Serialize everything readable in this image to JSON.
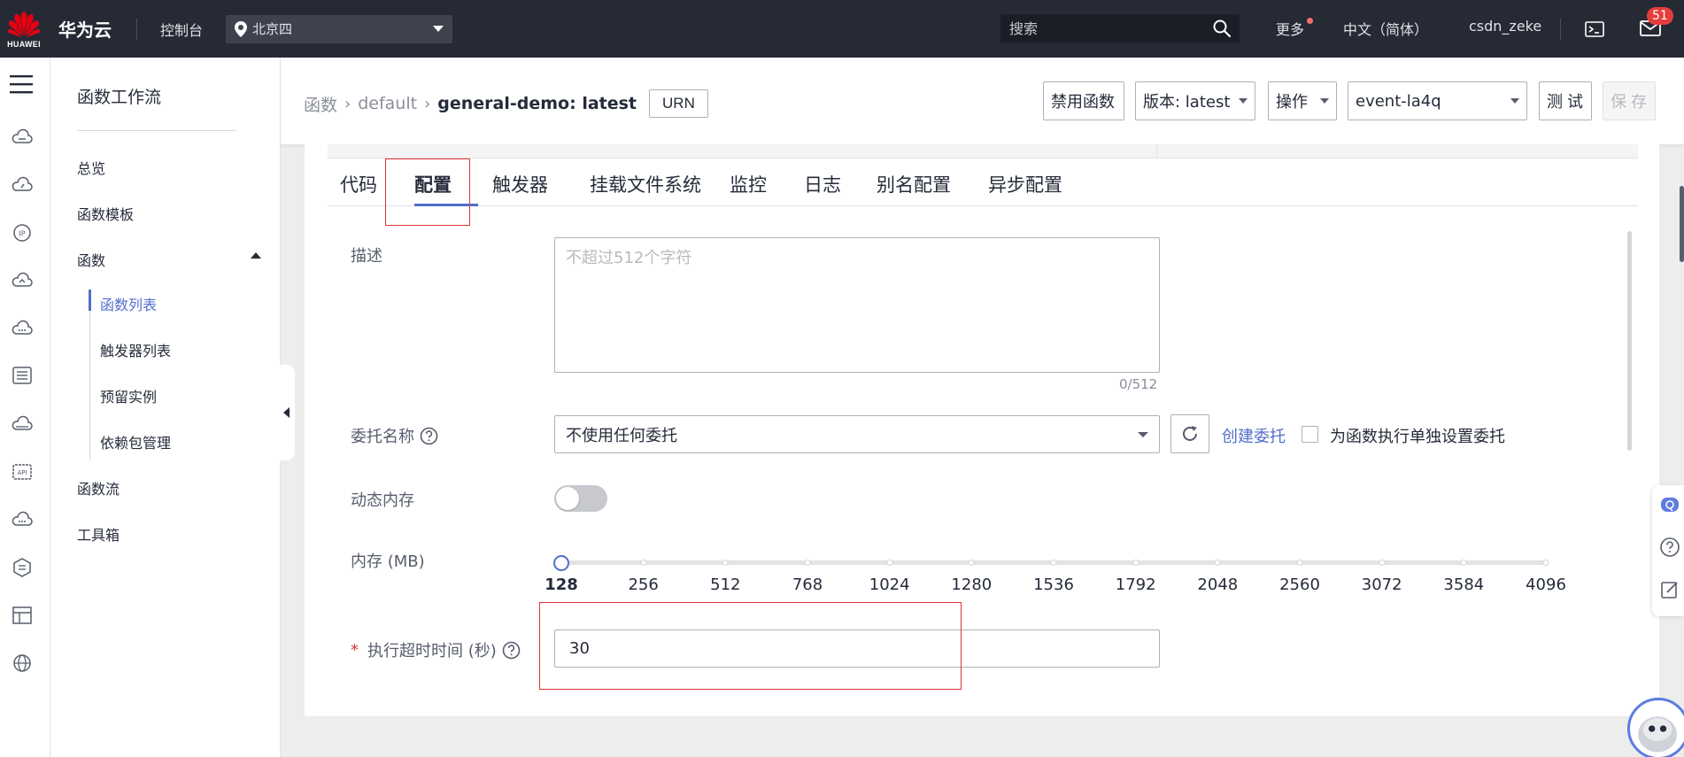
{
  "header": {
    "logo_text": "HUAWEI",
    "brand": "华为云",
    "console": "控制台",
    "region": "北京四",
    "search_placeholder": "搜索",
    "more": "更多",
    "language": "中文（简体）",
    "username": "csdn_zeke",
    "notification_count": "51"
  },
  "sidebar": {
    "title": "函数工作流",
    "items": [
      {
        "label": "总览"
      },
      {
        "label": "函数模板"
      },
      {
        "label": "函数"
      },
      {
        "label": "函数流"
      },
      {
        "label": "工具箱"
      }
    ],
    "sub_items": [
      {
        "label": "函数列表",
        "active": true
      },
      {
        "label": "触发器列表"
      },
      {
        "label": "预留实例"
      },
      {
        "label": "依赖包管理"
      }
    ]
  },
  "breadcrumb": {
    "root": "函数",
    "app": "default",
    "current": "general-demo: latest",
    "urn_label": "URN"
  },
  "toolbar": {
    "disable_label": "禁用函数",
    "version_label": "版本: latest",
    "actions_label": "操作",
    "event_label": "event-la4q",
    "test_label": "测 试",
    "save_label": "保 存"
  },
  "tabs": [
    {
      "label": "代码"
    },
    {
      "label": "配置",
      "active": true
    },
    {
      "label": "触发器"
    },
    {
      "label": "挂载文件系统"
    },
    {
      "label": "监控"
    },
    {
      "label": "日志"
    },
    {
      "label": "别名配置"
    },
    {
      "label": "异步配置"
    }
  ],
  "form": {
    "description_label": "描述",
    "description_placeholder": "不超过512个字符",
    "description_count": "0/512",
    "agency_label": "委托名称",
    "agency_value": "不使用任何委托",
    "create_agency_link": "创建委托",
    "separate_agency_label": "为函数执行单独设置委托",
    "dynamic_memory_label": "动态内存",
    "dynamic_memory_enabled": false,
    "memory_label": "内存 (MB)",
    "memory_options": [
      "128",
      "256",
      "512",
      "768",
      "1024",
      "1280",
      "1536",
      "1792",
      "2048",
      "2560",
      "3072",
      "3584",
      "4096"
    ],
    "memory_selected": "128",
    "timeout_label": "执行超时时间 (秒)",
    "timeout_value": "30"
  },
  "colors": {
    "header_bg": "#252a35",
    "accent": "#526ecc",
    "highlight": "#e0323b",
    "badge": "#e53c3c"
  }
}
